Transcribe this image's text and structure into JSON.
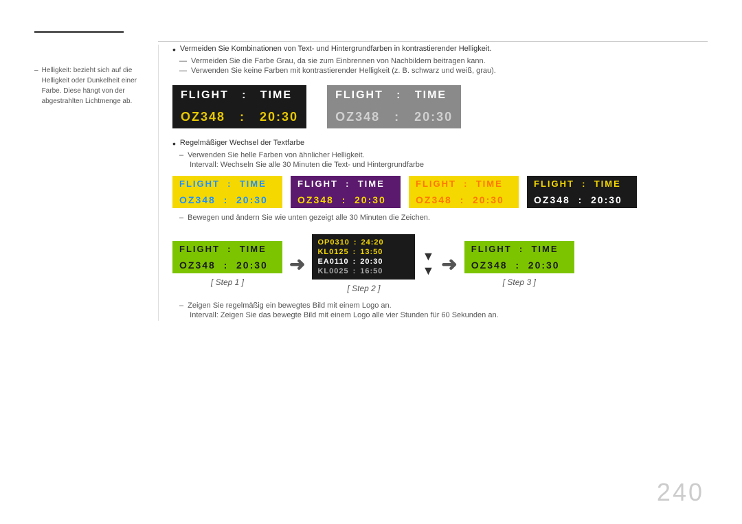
{
  "page": {
    "number": "240"
  },
  "sidebar": {
    "bullet_text": "Helligkeit: bezieht sich auf die Helligkeit oder Dunkelheit einer Farbe. Diese hängt von der abgestrahlten Lichtmenge ab."
  },
  "main": {
    "bullet1": "Vermeiden Sie Kombinationen von Text- und Hintergrundfarben in kontrastierender Helligkeit.",
    "dash1": "Vermeiden Sie die Farbe Grau, da sie zum Einbrennen von Nachbildern beitragen kann.",
    "dash2": "Verwenden Sie keine Farben mit kontrastierender Helligkeit (z. B. schwarz und weiß, grau).",
    "bullet2": "Regelmäßiger Wechsel der Textfarbe",
    "sub_dash1": "Verwenden Sie helle Farben von ähnlicher Helligkeit.",
    "sub_dash2": "Intervall: Wechseln Sie alle 30 Minuten die Text- und Hintergrundfarbe",
    "note_dash": "Bewegen und ändern Sie wie unten gezeigt alle 30 Minuten die Zeichen.",
    "note2_dash1": "Zeigen Sie regelmäßig ein bewegtes Bild mit einem Logo an.",
    "note2_dash2": "Intervall: Zeigen Sie das bewegte Bild mit einem Logo alle vier Stunden für 60 Sekunden an."
  },
  "panels": {
    "flight_label": "FLIGHT",
    "time_label": "TIME",
    "colon": ":",
    "oz348": "OZ348",
    "time_val": "20:30",
    "panel1": {
      "theme": "dark"
    },
    "panel2": {
      "theme": "gray"
    }
  },
  "color_panels": [
    {
      "theme": "blue-on-yellow",
      "header_color": "#1e90ff",
      "bg": "#f5d800"
    },
    {
      "theme": "white-on-purple",
      "header_color": "#ffffff",
      "bg": "#7b2d8b",
      "body_color": "#f5d800"
    },
    {
      "theme": "orange-on-yellow",
      "header_color": "#ff7700",
      "bg": "#f5d800"
    },
    {
      "theme": "yellow-on-dark",
      "header_color": "#f5d800",
      "bg": "#1a1a1a",
      "body_color": "#ffffff"
    }
  ],
  "steps": {
    "step1_label": "[ Step 1 ]",
    "step2_label": "[ Step 2 ]",
    "step3_label": "[ Step 3 ]",
    "step2_flights": [
      {
        "code": "OP0310",
        "sep": ":",
        "time": "24:20",
        "highlight": true
      },
      {
        "code": "KL0125",
        "sep": ":",
        "time": "13:50",
        "highlight": true
      },
      {
        "code": "EA0110",
        "sep": ":",
        "time": "20:30",
        "highlight": false
      },
      {
        "code": "KL0025",
        "sep": ":",
        "time": "16:50",
        "highlight": false
      }
    ]
  }
}
